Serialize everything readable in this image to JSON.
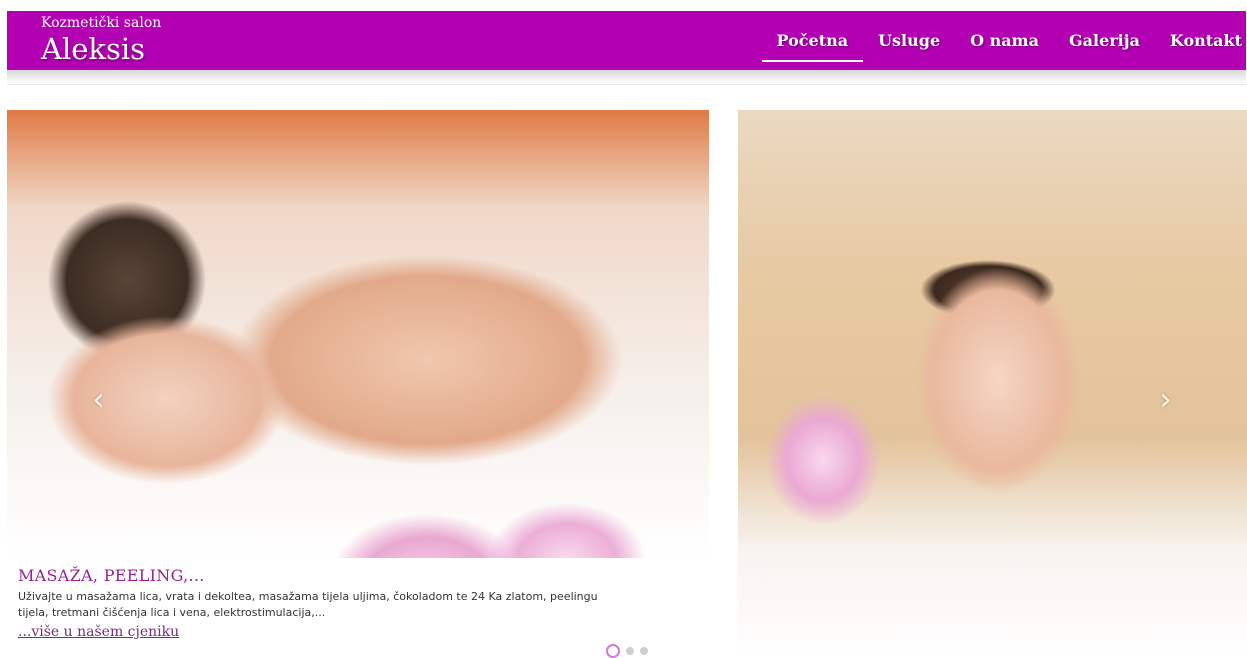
{
  "brand": {
    "subtitle": "Kozmetički salon",
    "name": "Aleksis"
  },
  "nav": {
    "items": [
      {
        "label": "Početna",
        "active": true
      },
      {
        "label": "Usluge",
        "active": false
      },
      {
        "label": "O nama",
        "active": false
      },
      {
        "label": "Galerija",
        "active": false
      },
      {
        "label": "Kontakt",
        "active": false
      }
    ]
  },
  "slider": {
    "prev_icon": "chevron-left-icon",
    "next_icon": "chevron-right-icon",
    "prev_glyph": "‹",
    "next_glyph": "›",
    "caption": {
      "title": "MASAŽA, PEELING,...",
      "text": "Uživajte u masažama lica, vrata i dekoltea, masažama tijela uljima, čokoladom te 24 Ka zlatom, peelingu tijela, tretmani čišćenja lica i vena, elektrostimulacija,...",
      "link": "...više u našem cjeniku"
    },
    "dots": 3,
    "active_dot": 0
  },
  "colors": {
    "header_bg": "#b300b3",
    "caption_title": "#9a1e9a"
  }
}
